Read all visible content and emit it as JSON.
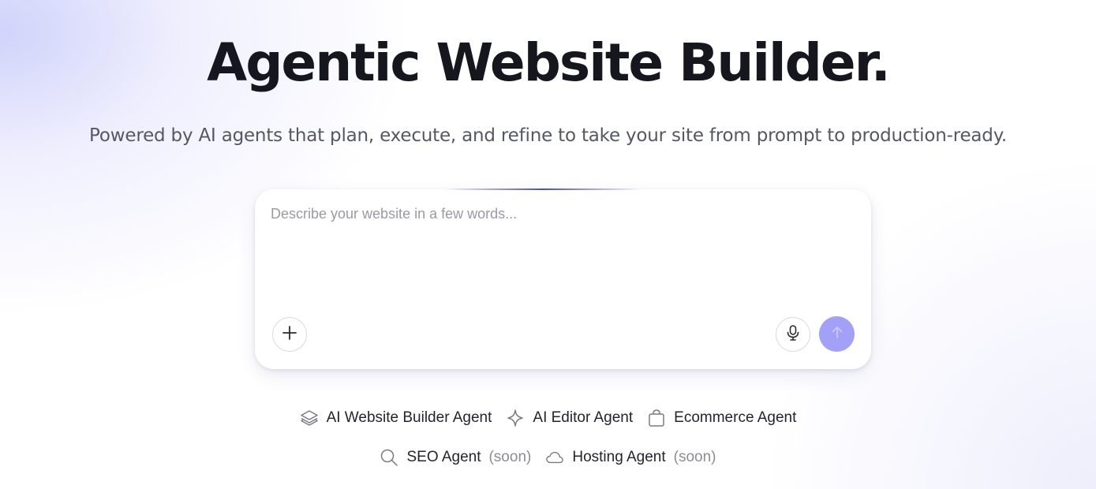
{
  "hero": {
    "title": "Agentic Website Builder.",
    "subtitle": "Powered by AI agents that plan, execute, and refine to take your site from prompt to production-ready."
  },
  "composer": {
    "placeholder": "Describe your website in a few words...",
    "value": "",
    "add_icon": "plus-icon",
    "mic_icon": "microphone-icon",
    "send_icon": "arrow-up-icon",
    "send_color": "#a3a0f7"
  },
  "agents": {
    "row1": [
      {
        "label": "AI Website Builder Agent",
        "icon": "layers-icon"
      },
      {
        "label": "AI Editor Agent",
        "icon": "sparkle-icon"
      },
      {
        "label": "Ecommerce Agent",
        "icon": "shopping-bag-icon"
      }
    ],
    "row2": [
      {
        "label": "SEO Agent",
        "status": "(soon)",
        "icon": "search-icon"
      },
      {
        "label": "Hosting Agent",
        "status": "(soon)",
        "icon": "cloud-icon"
      }
    ]
  }
}
